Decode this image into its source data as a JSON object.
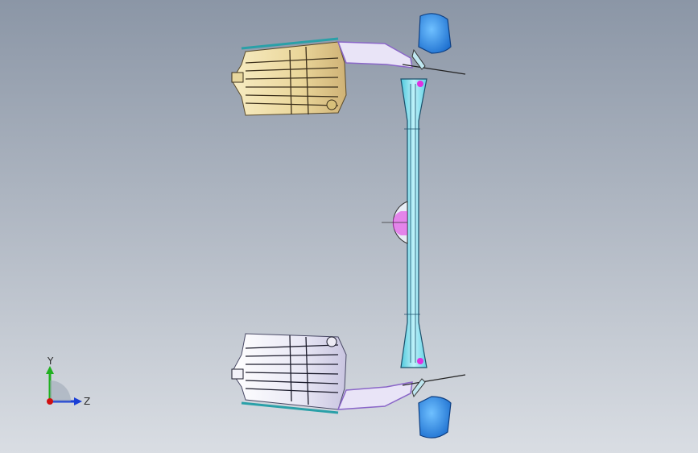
{
  "viewport": {
    "background_top": "#8b96a6",
    "background_bottom": "#d9dde3"
  },
  "triad": {
    "y_label": "Y",
    "z_label": "Z",
    "y_color": "#20b020",
    "z_color": "#1a3fd6",
    "x_color": "#d01010"
  },
  "model": {
    "tank_upper_color": "#f1e0a6",
    "tank_lower_color": "#f3f3fb",
    "bracket_color": "#8a66c8",
    "beam_color": "#9be6f3",
    "mirror_color": "#2f8fe6",
    "accent_color": "#e030e0"
  }
}
